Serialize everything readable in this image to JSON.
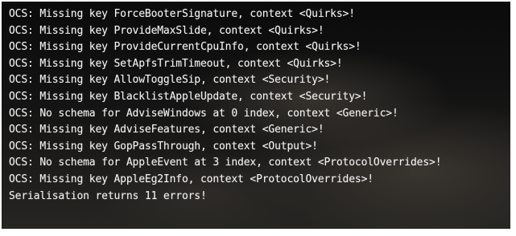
{
  "console": {
    "lines": [
      "OCS: Missing key ForceBooterSignature, context <Quirks>!",
      "OCS: Missing key ProvideMaxSlide, context <Quirks>!",
      "OCS: Missing key ProvideCurrentCpuInfo, context <Quirks>!",
      "OCS: Missing key SetApfsTrimTimeout, context <Quirks>!",
      "OCS: Missing key AllowToggleSip, context <Security>!",
      "OCS: Missing key BlacklistAppleUpdate, context <Security>!",
      "OCS: No schema for AdviseWindows at 0 index, context <Generic>!",
      "OCS: Missing key AdviseFeatures, context <Generic>!",
      "OCS: Missing key GopPassThrough, context <Output>!",
      "OCS: No schema for AppleEvent at 3 index, context <ProtocolOverrides>!",
      "OCS: Missing key AppleEg2Info, context <ProtocolOverrides>!",
      "Serialisation returns 11 errors!"
    ]
  }
}
